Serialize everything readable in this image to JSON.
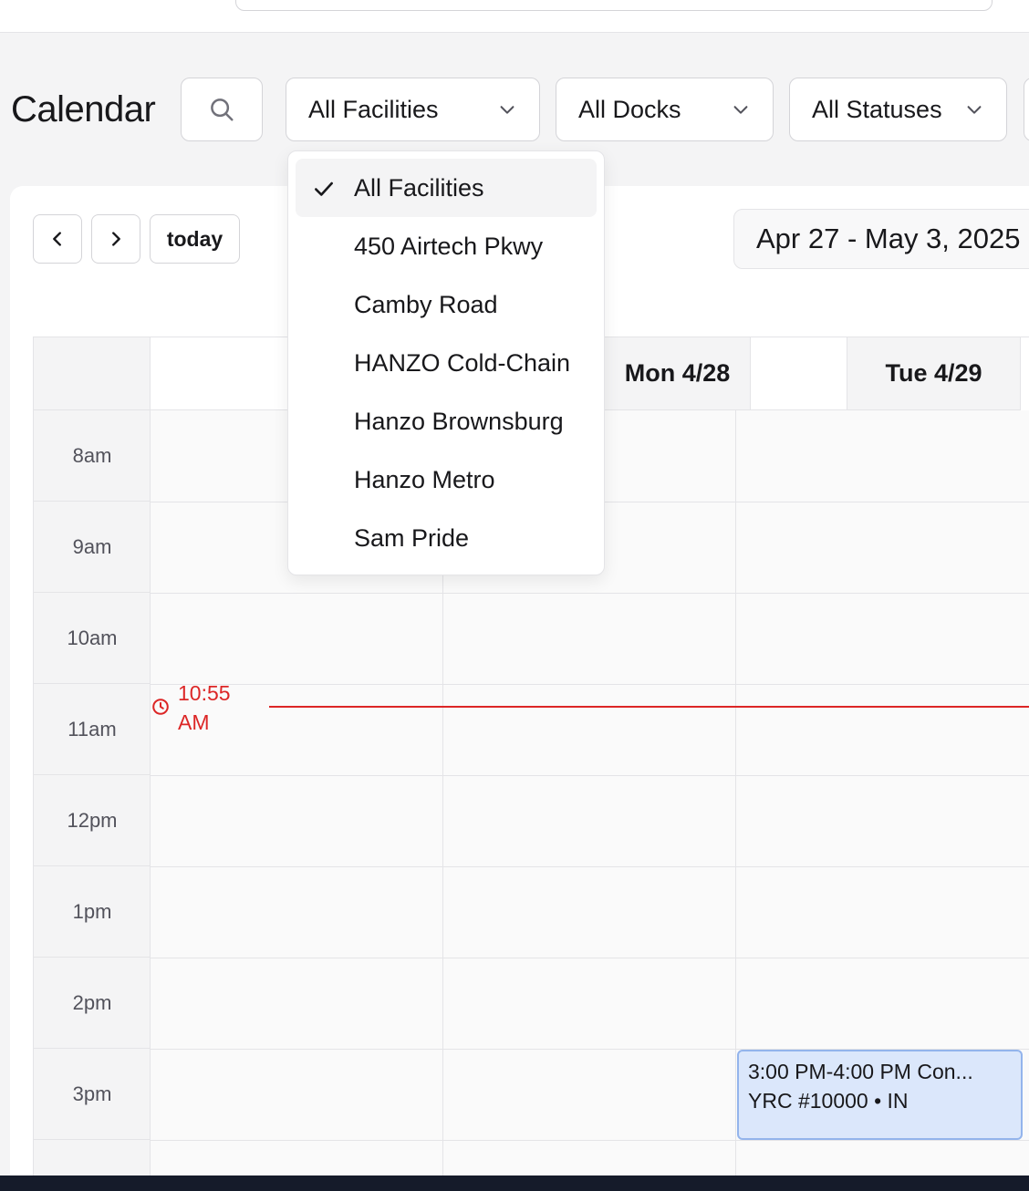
{
  "page": {
    "title": "Calendar"
  },
  "filters": {
    "facility": {
      "value": "All Facilities"
    },
    "dock": {
      "value": "All Docks"
    },
    "status": {
      "value": "All Statuses"
    }
  },
  "facility_dropdown": {
    "open": true,
    "options": [
      {
        "label": "All Facilities",
        "selected": true
      },
      {
        "label": "450 Airtech Pkwy",
        "selected": false
      },
      {
        "label": "Camby Road",
        "selected": false
      },
      {
        "label": "HANZO Cold-Chain",
        "selected": false
      },
      {
        "label": "Hanzo Brownsburg",
        "selected": false
      },
      {
        "label": "Hanzo Metro",
        "selected": false
      },
      {
        "label": "Sam Pride",
        "selected": false
      }
    ]
  },
  "toolbar": {
    "today_label": "today",
    "date_range": "Apr 27 - May 3, 2025"
  },
  "calendar": {
    "days": [
      "Mon 4/28",
      "Tue 4/29"
    ],
    "hours": [
      "8am",
      "9am",
      "10am",
      "11am",
      "12pm",
      "1pm",
      "2pm",
      "3pm"
    ],
    "now_indicator": {
      "time_line1": "10:55",
      "time_line2": "AM"
    },
    "events": [
      {
        "title": "3:00 PM-4:00 PM Con...",
        "subtitle": "YRC #10000 • IN"
      }
    ]
  },
  "colors": {
    "now_indicator": "#dc2626",
    "event_bg": "#dbe7fb",
    "event_border": "#93b4ec",
    "bottom_bar": "#151b2a"
  }
}
